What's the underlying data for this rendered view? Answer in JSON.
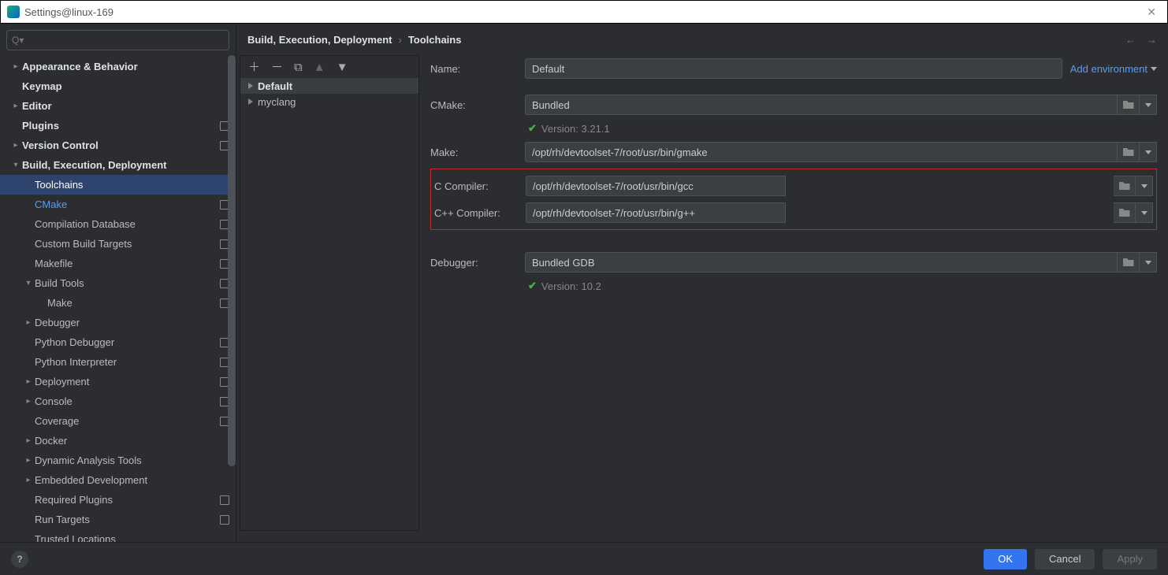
{
  "window": {
    "title": "Settings@linux-169"
  },
  "search": {
    "placeholder": ""
  },
  "tree": [
    {
      "label": "Appearance & Behavior",
      "indent": 0,
      "chev": ">",
      "bold": true
    },
    {
      "label": "Keymap",
      "indent": 0,
      "chev": "",
      "bold": true
    },
    {
      "label": "Editor",
      "indent": 0,
      "chev": ">",
      "bold": true
    },
    {
      "label": "Plugins",
      "indent": 0,
      "chev": "",
      "bold": true,
      "mod": true
    },
    {
      "label": "Version Control",
      "indent": 0,
      "chev": ">",
      "bold": true,
      "mod": true
    },
    {
      "label": "Build, Execution, Deployment",
      "indent": 0,
      "chev": "v",
      "bold": true
    },
    {
      "label": "Toolchains",
      "indent": 1,
      "chev": "",
      "selected": true
    },
    {
      "label": "CMake",
      "indent": 1,
      "chev": "",
      "mod": true,
      "activeBlue": true
    },
    {
      "label": "Compilation Database",
      "indent": 1,
      "chev": "",
      "mod": true
    },
    {
      "label": "Custom Build Targets",
      "indent": 1,
      "chev": "",
      "mod": true
    },
    {
      "label": "Makefile",
      "indent": 1,
      "chev": "",
      "mod": true
    },
    {
      "label": "Build Tools",
      "indent": 1,
      "chev": "v",
      "mod": true
    },
    {
      "label": "Make",
      "indent": 2,
      "chev": "",
      "mod": true
    },
    {
      "label": "Debugger",
      "indent": 1,
      "chev": ">"
    },
    {
      "label": "Python Debugger",
      "indent": 1,
      "chev": "",
      "mod": true
    },
    {
      "label": "Python Interpreter",
      "indent": 1,
      "chev": "",
      "mod": true
    },
    {
      "label": "Deployment",
      "indent": 1,
      "chev": ">",
      "mod": true
    },
    {
      "label": "Console",
      "indent": 1,
      "chev": ">",
      "mod": true
    },
    {
      "label": "Coverage",
      "indent": 1,
      "chev": "",
      "mod": true
    },
    {
      "label": "Docker",
      "indent": 1,
      "chev": ">"
    },
    {
      "label": "Dynamic Analysis Tools",
      "indent": 1,
      "chev": ">"
    },
    {
      "label": "Embedded Development",
      "indent": 1,
      "chev": ">"
    },
    {
      "label": "Required Plugins",
      "indent": 1,
      "chev": "",
      "mod": true
    },
    {
      "label": "Run Targets",
      "indent": 1,
      "chev": "",
      "mod": true
    },
    {
      "label": "Trusted Locations",
      "indent": 1,
      "chev": ""
    }
  ],
  "breadcrumbs": {
    "a": "Build, Execution, Deployment",
    "sep": "›",
    "b": "Toolchains"
  },
  "toolchains": {
    "items": [
      {
        "name": "Default",
        "selected": true
      },
      {
        "name": "myclang",
        "selected": false
      }
    ]
  },
  "form": {
    "name_label": "Name:",
    "name_value": "Default",
    "add_env": "Add environment",
    "cmake_label": "CMake:",
    "cmake_value": "Bundled",
    "cmake_version": "Version: 3.21.1",
    "make_label": "Make:",
    "make_value": "/opt/rh/devtoolset-7/root/usr/bin/gmake",
    "cc_label": "C Compiler:",
    "cc_value": "/opt/rh/devtoolset-7/root/usr/bin/gcc",
    "cxx_label": "C++ Compiler:",
    "cxx_value": "/opt/rh/devtoolset-7/root/usr/bin/g++",
    "dbg_label": "Debugger:",
    "dbg_value": "Bundled GDB",
    "dbg_version": "Version: 10.2"
  },
  "buttons": {
    "ok": "OK",
    "cancel": "Cancel",
    "apply": "Apply"
  }
}
